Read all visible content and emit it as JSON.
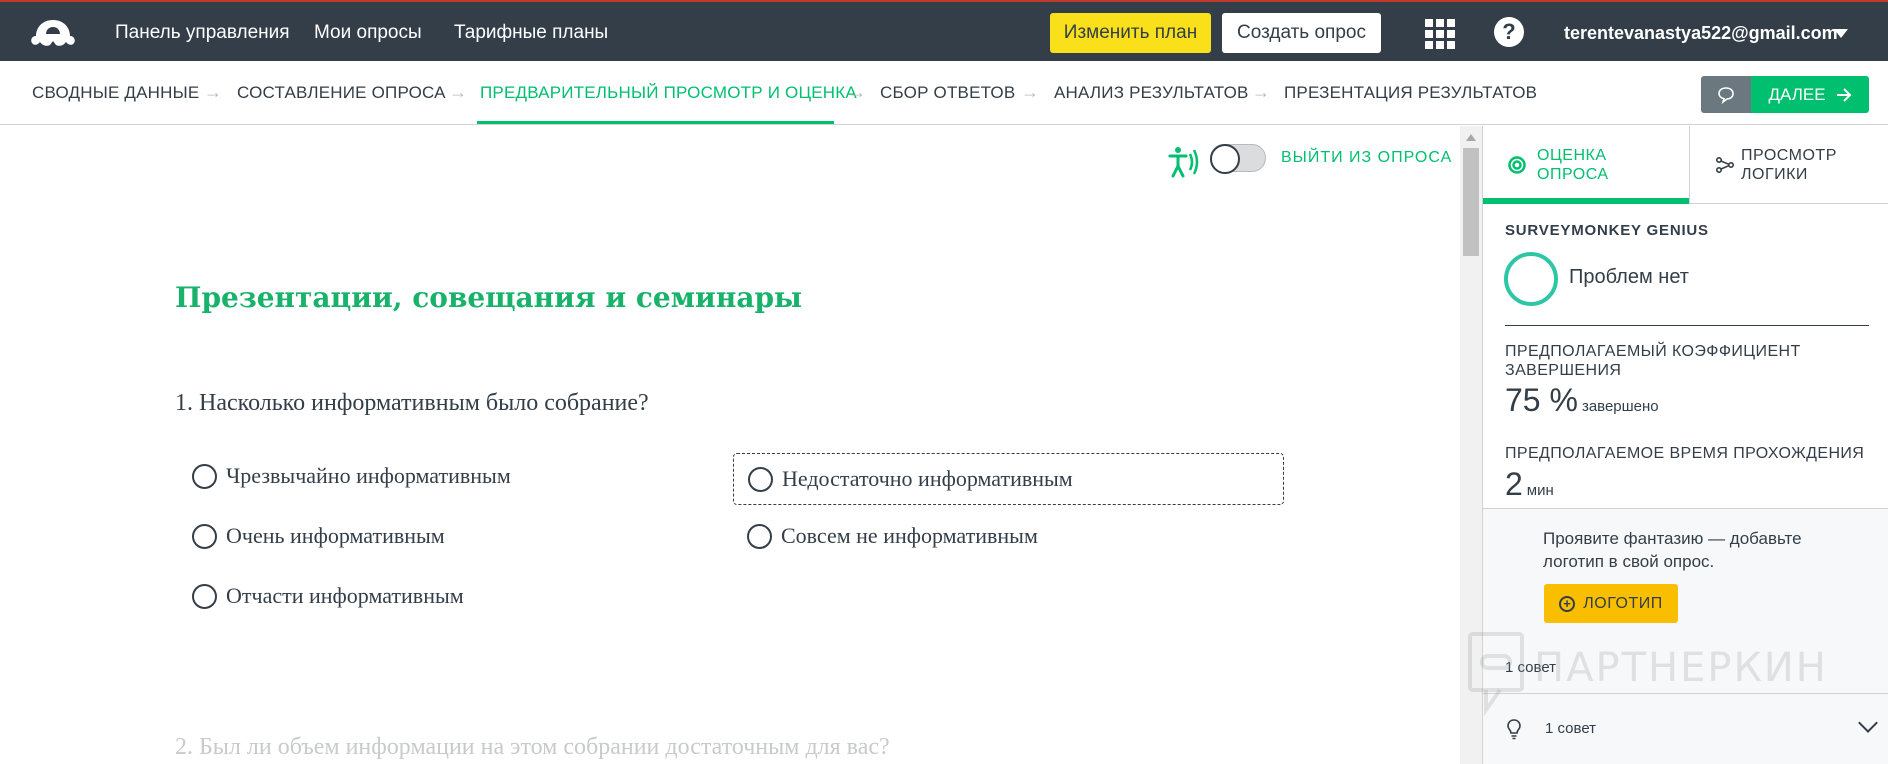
{
  "topbar": {
    "nav": [
      "Панель управления",
      "Мои опросы",
      "Тарифные планы"
    ],
    "upgrade_label": "Изменить план",
    "create_label": "Создать опрос",
    "help_symbol": "?",
    "user_email": "terentevanastya522@gmail.com"
  },
  "steps": {
    "items": [
      "СВОДНЫЕ ДАННЫЕ",
      "СОСТАВЛЕНИЕ ОПРОСА",
      "ПРЕДВАРИТЕЛЬНЫЙ ПРОСМОТР И ОЦЕНКА",
      "СБОР ОТВЕТОВ",
      "АНАЛИЗ РЕЗУЛЬТАТОВ",
      "ПРЕЗЕНТАЦИЯ РЕЗУЛЬТАТОВ"
    ],
    "active_index": 2,
    "next_label": "ДАЛЕЕ"
  },
  "survey": {
    "exit_label": "ВЫЙТИ ИЗ ОПРОСА",
    "title": "Презентации, совещания и семинары",
    "q1": "1. Насколько информативным было собрание?",
    "options": [
      "Чрезвычайно информативным",
      "Недостаточно информативным",
      "Очень информативным",
      "Совсем не информативным",
      "Отчасти информативным"
    ],
    "q2": "2. Был ли объем информации на этом собрании достаточным для вас?"
  },
  "panel": {
    "tab_score": [
      "ОЦЕНКА",
      "ОПРОСА"
    ],
    "tab_logic": [
      "ПРОСМОТР",
      "ЛОГИКИ"
    ],
    "genius_heading": "SURVEYMONKEY GENIUS",
    "genius_status": "Проблем нет",
    "completion_label": "ПРЕДПОЛАГАЕМЫЙ КОЭФФИЦИЕНТ ЗАВЕРШЕНИЯ",
    "completion_value": "75 %",
    "completion_unit": "завершено",
    "time_label": "ПРЕДПОЛАГАЕМОЕ ВРЕМЯ ПРОХОЖДЕНИЯ",
    "time_value": "2",
    "time_unit": "мин",
    "promo_text": "Проявите фантазию — добавьте логотип в свой опрос.",
    "logo_button": "ЛОГОТИП",
    "tips_count": "1 совет",
    "tip_row_label": "1 совет"
  },
  "watermark": "ПАРТНЕРКИН",
  "colors": {
    "topbar": "#333e48",
    "accent_green": "#00bf6f",
    "upgrade_yellow": "#f9e01b",
    "logo_yellow": "#f9be00"
  }
}
